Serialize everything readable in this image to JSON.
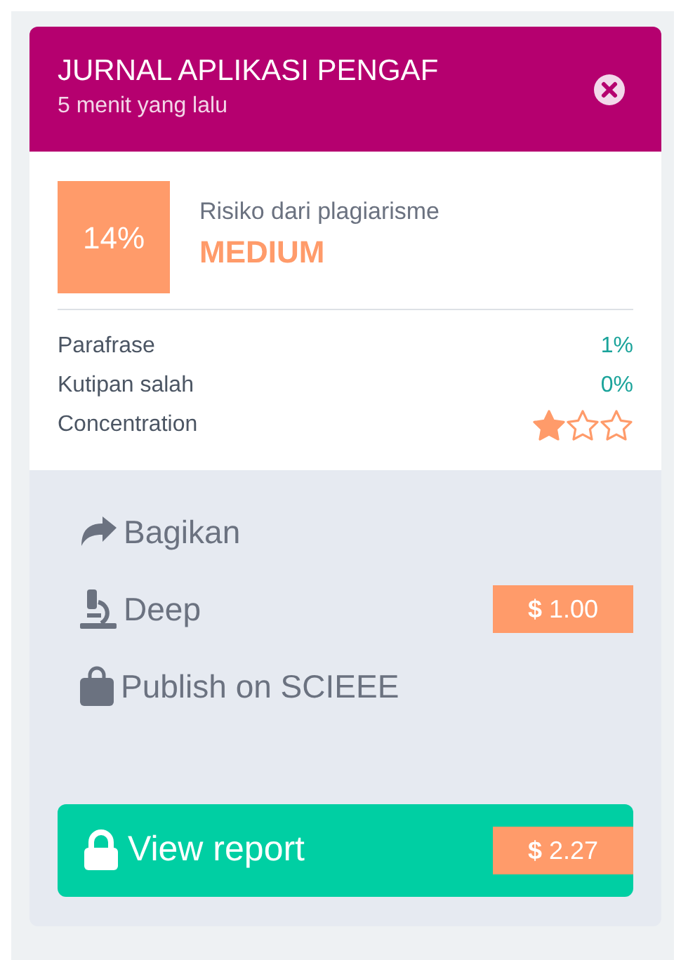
{
  "header": {
    "title": "JURNAL APLIKASI PENGAF",
    "subtitle": "5 menit yang lalu"
  },
  "risk": {
    "percent": "14%",
    "label": "Risiko dari plagiarisme",
    "level_text": "MEDIUM"
  },
  "metrics": [
    {
      "label": "Parafrase",
      "value": "1%"
    },
    {
      "label": "Kutipan salah",
      "value": "0%"
    }
  ],
  "concentration": {
    "label": "Concentration",
    "stars": 1
  },
  "actions": [
    {
      "kind": "share",
      "label": "Bagikan"
    },
    {
      "kind": "deep",
      "label": "Deep",
      "price": "**$** 1.00"
    },
    {
      "kind": "publish",
      "label": "Publish on SCIEEE"
    }
  ],
  "report_button": {
    "label": "View report",
    "price": "**$** 2.27"
  }
}
